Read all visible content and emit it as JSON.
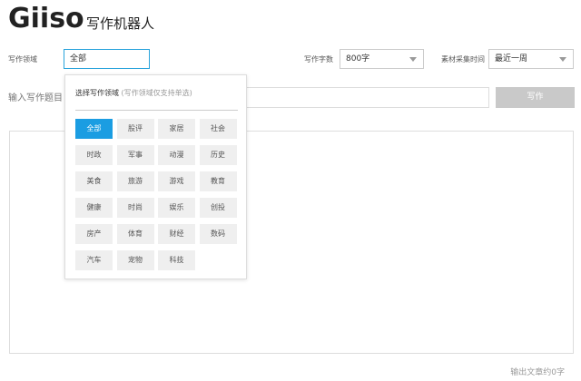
{
  "header": {
    "logo_text": "Giiso",
    "app_title": "写作机器人"
  },
  "settings": {
    "domain_label": "写作领域",
    "domain_value": "全部",
    "wordcount_label": "写作字数",
    "wordcount_value": "800字",
    "period_label": "素材采集时间",
    "period_value": "最近一周"
  },
  "topic": {
    "placeholder": "输入写作题目",
    "write_button": "写作"
  },
  "dropdown": {
    "title": "选择写作领域",
    "hint": "(写作领域仅支持单选)",
    "selected": "全部",
    "categories": [
      "全部",
      "股评",
      "家居",
      "社会",
      "时政",
      "军事",
      "动漫",
      "历史",
      "美食",
      "旅游",
      "游戏",
      "教育",
      "健康",
      "时尚",
      "娱乐",
      "创投",
      "房产",
      "体育",
      "财经",
      "数码",
      "汽车",
      "宠物",
      "科技"
    ]
  },
  "output": {
    "counter": "输出文章约0字"
  },
  "colors": {
    "accent": "#1b9de2",
    "button_disabled": "#c9c9c9",
    "focus_border": "#29a3dc"
  }
}
